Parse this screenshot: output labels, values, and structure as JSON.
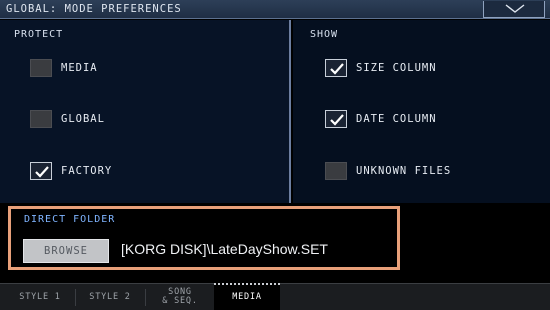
{
  "titlebar": {
    "title": "GLOBAL: MODE PREFERENCES",
    "menu_icon": "chevron-down-icon"
  },
  "protect": {
    "header": "PROTECT",
    "items": [
      {
        "label": "MEDIA",
        "checked": false
      },
      {
        "label": "GLOBAL",
        "checked": false
      },
      {
        "label": "FACTORY",
        "checked": true
      }
    ]
  },
  "show": {
    "header": "SHOW",
    "items": [
      {
        "label": "SIZE COLUMN",
        "checked": true
      },
      {
        "label": "DATE COLUMN",
        "checked": true
      },
      {
        "label": "UNKNOWN FILES",
        "checked": false
      }
    ]
  },
  "direct_folder": {
    "header": "DIRECT FOLDER",
    "browse_label": "BROWSE",
    "path": "[KORG DISK]\\LateDayShow.SET"
  },
  "tabs": [
    {
      "label": "STYLE 1",
      "active": false
    },
    {
      "label": "STYLE 2",
      "active": false
    },
    {
      "label_line1": "SONG",
      "label_line2": "& SEQ.",
      "active": false
    },
    {
      "label": "MEDIA",
      "active": true
    }
  ],
  "colors": {
    "highlight_border": "#e8a07a",
    "section_header_blue": "#7fb4ff",
    "titlebar_bg": "#2d3f58"
  }
}
